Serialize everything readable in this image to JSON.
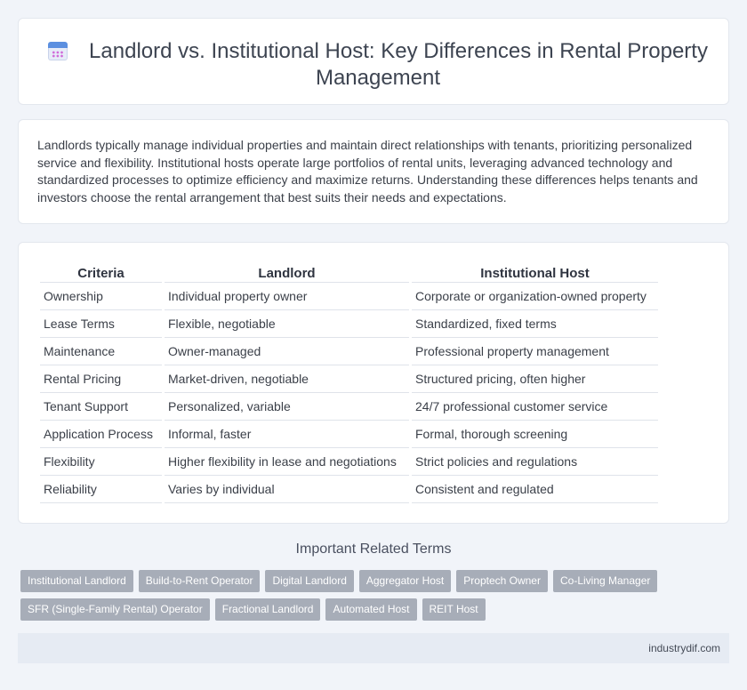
{
  "header": {
    "title": "Landlord vs. Institutional Host: Key Differences in Rental Property Management",
    "icon": "calendar-icon"
  },
  "intro": {
    "text": "Landlords typically manage individual properties and maintain direct relationships with tenants, prioritizing personalized service and flexibility. Institutional hosts operate large portfolios of rental units, leveraging advanced technology and standardized processes to optimize efficiency and maximize returns. Understanding these differences helps tenants and investors choose the rental arrangement that best suits their needs and expectations."
  },
  "table": {
    "headers": [
      "Criteria",
      "Landlord",
      "Institutional Host"
    ],
    "rows": [
      [
        "Ownership",
        "Individual property owner",
        "Corporate or organization-owned property"
      ],
      [
        "Lease Terms",
        "Flexible, negotiable",
        "Standardized, fixed terms"
      ],
      [
        "Maintenance",
        "Owner-managed",
        "Professional property management"
      ],
      [
        "Rental Pricing",
        "Market-driven, negotiable",
        "Structured pricing, often higher"
      ],
      [
        "Tenant Support",
        "Personalized, variable",
        "24/7 professional customer service"
      ],
      [
        "Application Process",
        "Informal, faster",
        "Formal, thorough screening"
      ],
      [
        "Flexibility",
        "Higher flexibility in lease and negotiations",
        "Strict policies and regulations"
      ],
      [
        "Reliability",
        "Varies by individual",
        "Consistent and regulated"
      ]
    ]
  },
  "related": {
    "title": "Important Related Terms",
    "row1": [
      "Institutional Landlord",
      "Build-to-Rent Operator",
      "Digital Landlord",
      "Aggregator Host",
      "Proptech Owner",
      "Co-Living Manager"
    ],
    "row2": [
      "SFR (Single-Family Rental) Operator",
      "Fractional Landlord",
      "Automated Host",
      "REIT Host"
    ]
  },
  "footer": {
    "site": "industrydif.com"
  },
  "colors": {
    "background": "#f1f4f9",
    "tag": "#a7adb8",
    "footer": "#e6ebf3",
    "icon_accent": "#5b8fe0"
  }
}
